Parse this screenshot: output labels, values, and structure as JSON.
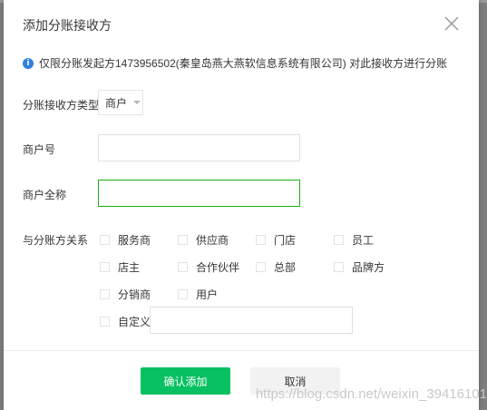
{
  "dialog": {
    "title": "添加分账接收方",
    "notice": "仅限分账发起方1473956502(秦皇岛燕大燕软信息系统有限公司) 对此接收方进行分账"
  },
  "form": {
    "type_label": "分账接收方类型",
    "type_value": "商户",
    "merchant_no_label": "商户号",
    "merchant_no_value": "",
    "merchant_name_label": "商户全称",
    "merchant_name_value": "",
    "relation_label": "与分账方关系",
    "relations": [
      "服务商",
      "供应商",
      "门店",
      "员工",
      "店主",
      "合作伙伴",
      "总部",
      "品牌方",
      "分销商",
      "用户",
      "自定义"
    ],
    "custom_value": ""
  },
  "buttons": {
    "confirm": "确认添加",
    "cancel": "取消"
  },
  "watermark": "https://blog.csdn.net/weixin_39416101",
  "colors": {
    "primary": "#07c160",
    "focus_border": "#1aad19",
    "info": "#2f7fe0"
  },
  "icons": [
    "close-icon",
    "info-icon",
    "caret-down-icon"
  ]
}
